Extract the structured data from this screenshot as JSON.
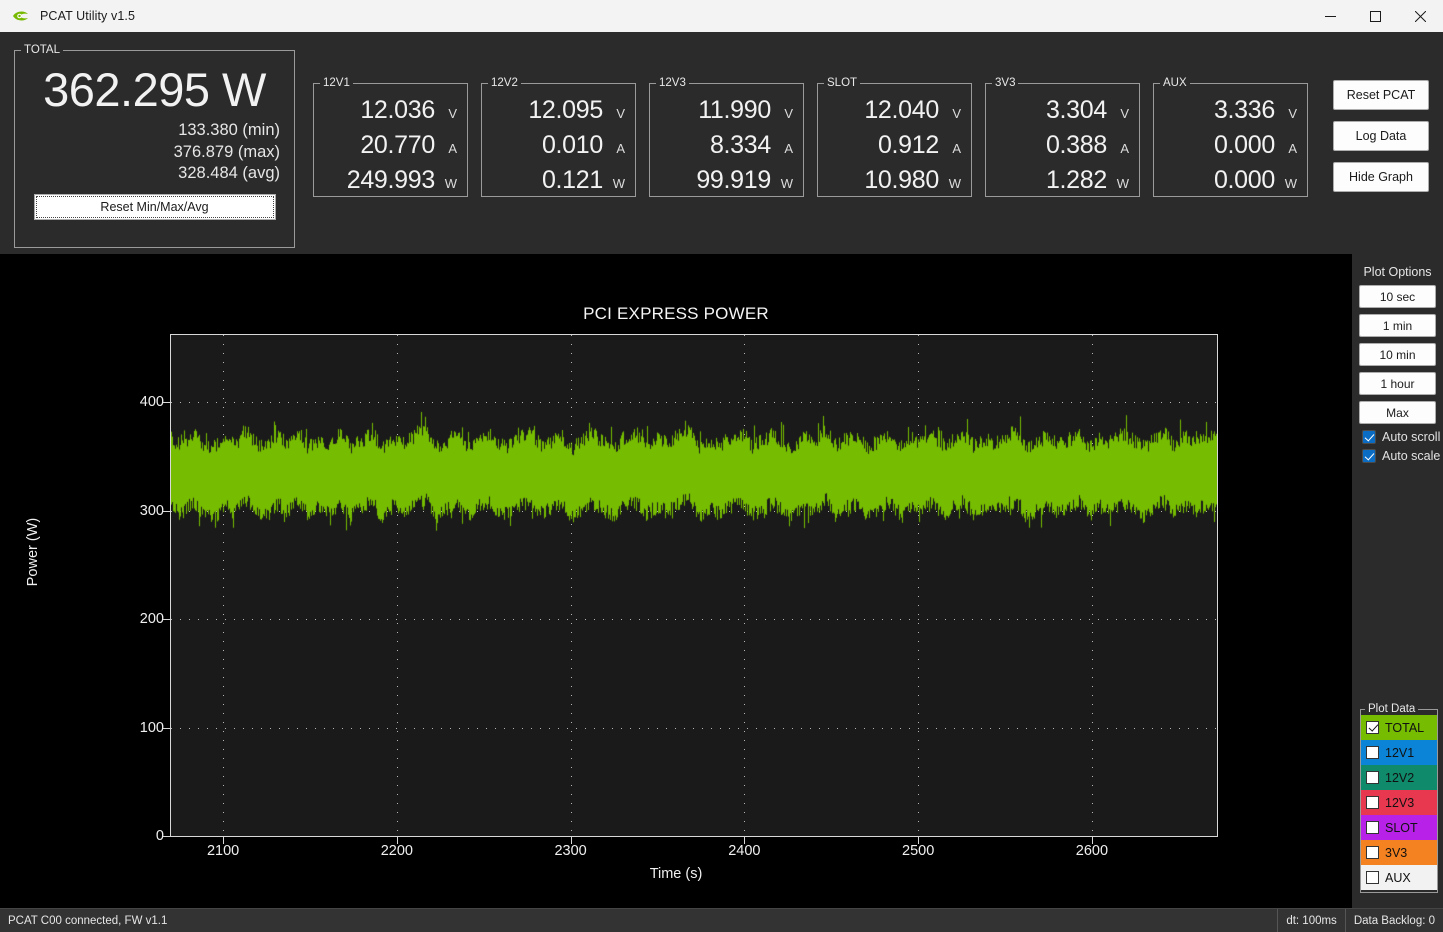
{
  "window": {
    "title": "PCAT Utility v1.5",
    "logo_icon": "nvidia-eye-logo",
    "minimize_icon": "minimize-icon",
    "maximize_icon": "maximize-icon",
    "close_icon": "close-icon"
  },
  "total": {
    "legend": "TOTAL",
    "value": "362.295 W",
    "min": "133.380 (min)",
    "max": "376.879 (max)",
    "avg": "328.484 (avg)",
    "reset_label": "Reset Min/Max/Avg"
  },
  "rails": [
    {
      "name": "12V1",
      "volts": "12.036",
      "amps": "20.770",
      "watts": "249.993"
    },
    {
      "name": "12V2",
      "volts": "12.095",
      "amps": "0.010",
      "watts": "0.121"
    },
    {
      "name": "12V3",
      "volts": "11.990",
      "amps": "8.334",
      "watts": "99.919"
    },
    {
      "name": "SLOT",
      "volts": "12.040",
      "amps": "0.912",
      "watts": "10.980"
    },
    {
      "name": "3V3",
      "volts": "3.304",
      "amps": "0.388",
      "watts": "1.282"
    },
    {
      "name": "AUX",
      "volts": "3.336",
      "amps": "0.000",
      "watts": "0.000"
    }
  ],
  "units": {
    "v": "V",
    "a": "A",
    "w": "W"
  },
  "actions": {
    "reset_pcat": "Reset PCAT",
    "log_data": "Log Data",
    "hide_graph": "Hide Graph"
  },
  "plot_options": {
    "title": "Plot Options",
    "ranges": [
      "10 sec",
      "1 min",
      "10 min",
      "1 hour",
      "Max"
    ],
    "auto_scroll": {
      "label": "Auto scroll",
      "checked": true
    },
    "auto_scale": {
      "label": "Auto scale",
      "checked": true
    }
  },
  "plot_data": {
    "legend": "Plot Data",
    "items": [
      {
        "label": "TOTAL",
        "color": "#76bc00",
        "checked": true
      },
      {
        "label": "12V1",
        "color": "#0b84d8",
        "checked": false
      },
      {
        "label": "12V2",
        "color": "#0f8a6a",
        "checked": false
      },
      {
        "label": "12V3",
        "color": "#e8384f",
        "checked": false
      },
      {
        "label": "SLOT",
        "color": "#b822e8",
        "checked": false
      },
      {
        "label": "3V3",
        "color": "#f58220",
        "checked": false
      },
      {
        "label": "AUX",
        "color": "#f2f2f2",
        "checked": false
      }
    ]
  },
  "statusbar": {
    "connection": "PCAT C00 connected, FW v1.1",
    "dt": "dt: 100ms",
    "backlog": "Data Backlog: 0"
  },
  "chart_data": {
    "type": "line",
    "title": "PCI EXPRESS POWER",
    "xlabel": "Time (s)",
    "ylabel": "Power (W)",
    "xlim": [
      2070,
      2672
    ],
    "ylim": [
      0,
      462
    ],
    "xticks": [
      2100,
      2200,
      2300,
      2400,
      2500,
      2600
    ],
    "yticks": [
      0,
      100,
      200,
      300,
      400
    ],
    "grid": true,
    "grid_style": "dotted",
    "legend_position": "right-panel",
    "background": "#1a1a1a",
    "series": [
      {
        "name": "TOTAL",
        "color": "#76bc00",
        "visible": true,
        "description": "dense high-frequency noise band",
        "band_min": 288,
        "band_max": 378,
        "band_mean": 330,
        "sample_interval_s": 0.1,
        "envelope_upper": [
          366,
          359,
          371,
          362,
          356,
          368,
          360,
          374,
          363,
          357,
          369,
          361,
          373,
          358,
          366,
          362,
          370,
          359,
          364,
          372,
          357,
          365,
          361,
          368,
          375,
          360,
          363,
          370,
          358,
          366,
          371,
          362,
          359,
          367,
          373,
          361,
          364,
          369,
          357,
          365,
          370,
          363,
          358,
          368,
          372,
          360,
          366,
          362,
          369,
          374,
          358,
          364,
          361,
          367,
          371,
          359,
          365,
          370,
          363,
          357,
          368,
          362,
          373,
          360,
          366,
          369,
          358,
          364,
          371,
          361,
          367,
          363,
          370,
          359,
          365,
          372,
          360,
          366,
          362,
          368,
          374,
          357,
          363,
          369,
          361,
          365,
          371,
          359,
          367,
          363,
          370,
          366,
          358,
          364,
          372,
          360,
          368,
          362,
          369,
          365
        ],
        "envelope_lower": [
          302,
          296,
          308,
          299,
          292,
          305,
          298,
          310,
          301,
          294,
          306,
          300,
          309,
          295,
          303,
          299,
          307,
          296,
          302,
          308,
          293,
          304,
          298,
          305,
          311,
          297,
          300,
          307,
          295,
          303,
          308,
          299,
          296,
          304,
          310,
          298,
          301,
          306,
          294,
          302,
          307,
          300,
          295,
          305,
          309,
          297,
          303,
          299,
          306,
          311,
          295,
          301,
          298,
          304,
          308,
          296,
          302,
          307,
          300,
          294,
          305,
          299,
          310,
          297,
          303,
          306,
          295,
          301,
          308,
          298,
          304,
          300,
          307,
          296,
          302,
          309,
          297,
          303,
          299,
          305,
          311,
          294,
          300,
          306,
          298,
          302,
          308,
          296,
          304,
          300,
          307,
          303,
          295,
          301,
          309,
          297,
          305,
          299,
          306,
          302
        ]
      }
    ]
  }
}
